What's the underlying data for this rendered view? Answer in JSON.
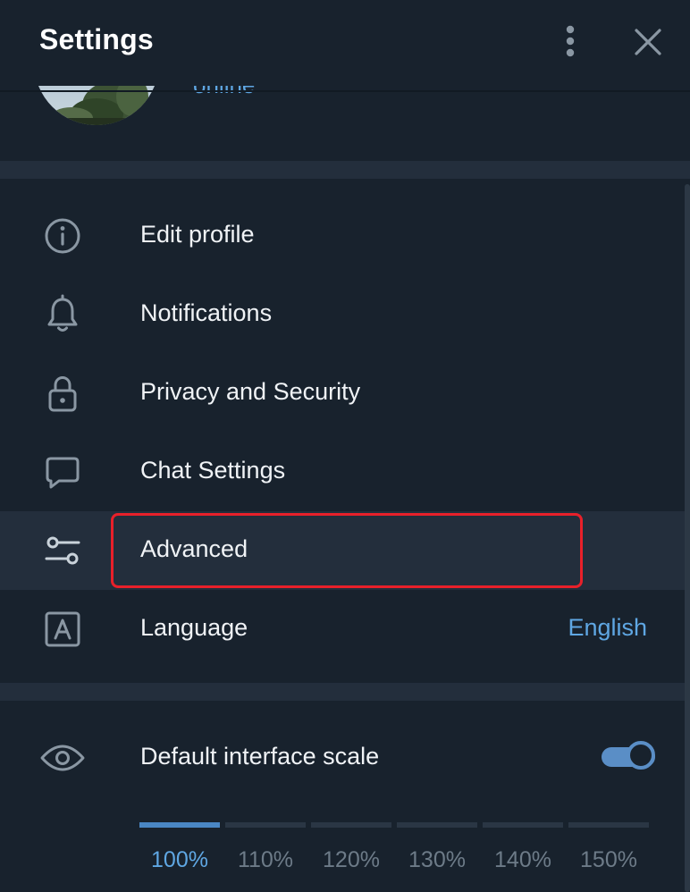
{
  "header": {
    "title": "Settings",
    "menu_icon": "more-vertical-icon",
    "close_icon": "close-icon"
  },
  "profile": {
    "status": "online",
    "avatar": "avatar-photo-trees"
  },
  "menu": {
    "items": [
      {
        "label": "Edit profile",
        "icon": "info-icon"
      },
      {
        "label": "Notifications",
        "icon": "bell-icon"
      },
      {
        "label": "Privacy and Security",
        "icon": "lock-icon"
      },
      {
        "label": "Chat Settings",
        "icon": "chat-bubble-icon"
      },
      {
        "label": "Advanced",
        "icon": "sliders-icon"
      },
      {
        "label": "Language",
        "icon": "language-icon",
        "value": "English"
      }
    ]
  },
  "scale": {
    "label": "Default interface scale",
    "icon": "eye-icon",
    "toggle_on": true,
    "options": [
      "100%",
      "110%",
      "120%",
      "130%",
      "140%",
      "150%"
    ],
    "selected": "100%"
  },
  "colors": {
    "background": "#18222d",
    "section_separator": "#232e3c",
    "accent": "#5fa7e3",
    "highlight": "#e8202a"
  }
}
